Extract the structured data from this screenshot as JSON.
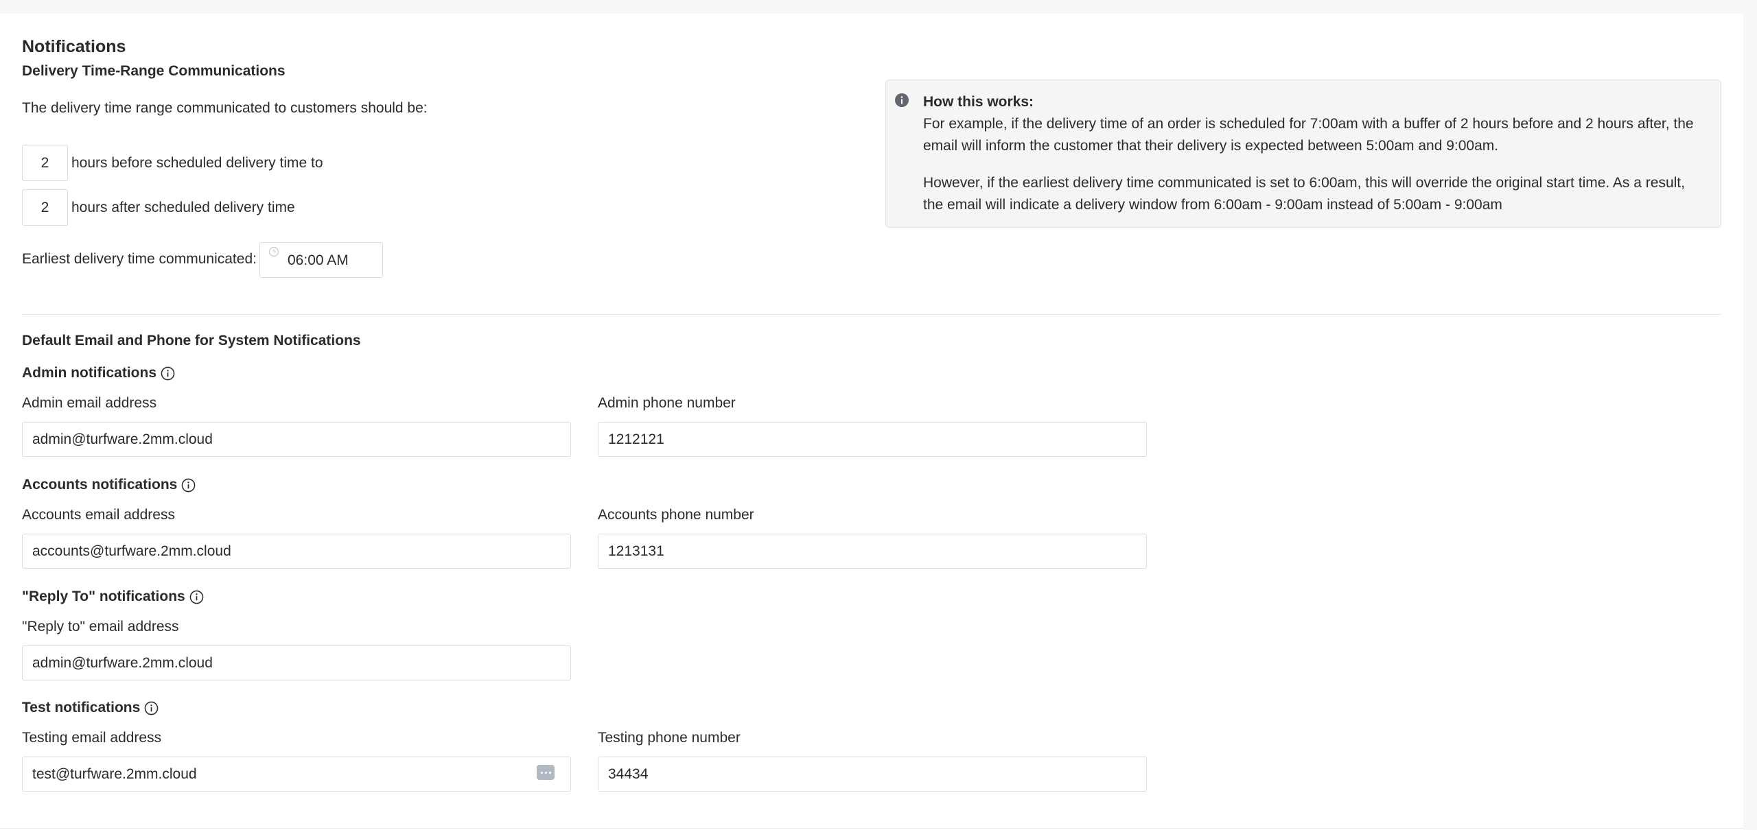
{
  "page": {
    "title": "Notifications"
  },
  "delivery": {
    "section_title": "Delivery Time-Range Communications",
    "intro": "The delivery time range communicated to customers should be:",
    "hours_before_value": "2",
    "hours_before_label": "hours before scheduled delivery time to",
    "hours_after_value": "2",
    "hours_after_label": "hours after scheduled delivery time",
    "earliest_label": "Earliest delivery time communicated:",
    "earliest_value": "06:00 AM"
  },
  "info": {
    "heading": "How this works:",
    "paragraph1": "For example, if the delivery time of an order is scheduled for 7:00am with a buffer of 2 hours before and 2 hours after, the email will inform the customer that their delivery is expected between 5:00am and 9:00am.",
    "paragraph2": "However, if the earliest delivery time communicated is set to 6:00am, this will override the original start time. As a result, the email will indicate a delivery window from 6:00am - 9:00am instead of 5:00am - 9:00am"
  },
  "defaults": {
    "section_title": "Default Email and Phone for System Notifications",
    "admin": {
      "title": "Admin notifications",
      "email_label": "Admin email address",
      "email_value": "admin@turfware.2mm.cloud",
      "phone_label": "Admin phone number",
      "phone_value": "1212121"
    },
    "accounts": {
      "title": "Accounts notifications",
      "email_label": "Accounts email address",
      "email_value": "accounts@turfware.2mm.cloud",
      "phone_label": "Accounts phone number",
      "phone_value": "1213131"
    },
    "reply_to": {
      "title": "\"Reply To\" notifications",
      "email_label": "\"Reply to\" email address",
      "email_value": "admin@turfware.2mm.cloud"
    },
    "test": {
      "title": "Test notifications",
      "email_label": "Testing email address",
      "email_value": "test@turfware.2mm.cloud",
      "phone_label": "Testing phone number",
      "phone_value": "34434"
    }
  },
  "icons": {
    "info": "info-circle-icon",
    "clock": "clock-icon",
    "password_manager": "password-manager-icon"
  },
  "colors": {
    "panel_bg": "#f5f5f5",
    "border": "#dcdcdc",
    "text": "#2b2b2b",
    "icon_grey": "#b3b9c2"
  }
}
